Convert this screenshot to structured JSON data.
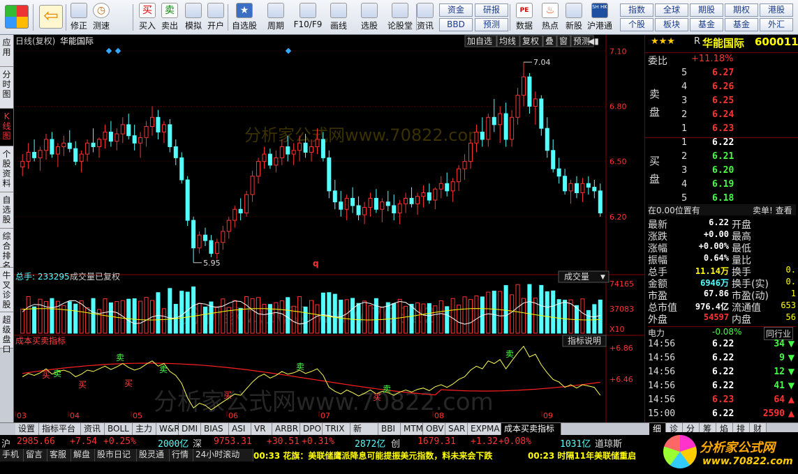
{
  "toolbar": {
    "buttons": [
      {
        "label": "",
        "icon": "grid-icon"
      },
      {
        "label": "",
        "icon": "back-arrow-icon"
      },
      {
        "label": "修正",
        "icon": "arrow-up-down-icon"
      },
      {
        "label": "测速",
        "icon": "clock-icon"
      },
      {
        "label": "买入",
        "icon": "buy-icon"
      },
      {
        "label": "卖出",
        "icon": "sell-icon"
      },
      {
        "label": "模拟",
        "icon": "hammer-icon"
      },
      {
        "label": "开户",
        "icon": "lock-icon"
      },
      {
        "label": "自选股",
        "icon": "star-icon"
      },
      {
        "label": "周期",
        "icon": "cycle-icon"
      },
      {
        "label": "F10/F9",
        "icon": "f10-icon"
      },
      {
        "label": "画线",
        "icon": "pencil-icon"
      },
      {
        "label": "选股",
        "icon": "filter-icon"
      },
      {
        "label": "论股堂",
        "icon": "forum-icon"
      },
      {
        "label": "资讯",
        "icon": "news-icon"
      },
      {
        "label": "数据",
        "icon": "pe-icon"
      },
      {
        "label": "热点",
        "icon": "hot-icon"
      },
      {
        "label": "新股",
        "icon": "ipo-icon"
      },
      {
        "label": "沪港通",
        "icon": "shhk-icon"
      }
    ],
    "glyphs": {
      "buy": "买",
      "sell": "卖",
      "grid": "▦",
      "back": "⇦",
      "pe": "PE",
      "shhk": "SH HK",
      "bbd": "BBD"
    },
    "mid_buttons": [
      "资金",
      "研报",
      "BBD",
      "预测"
    ],
    "right_buttons": [
      "指数",
      "全球",
      "期股",
      "期权",
      "港股",
      "个股",
      "板块",
      "基金",
      "基金",
      "外汇"
    ]
  },
  "left_tabs": [
    "应用",
    "分时图",
    "K线图",
    "个股资料",
    "自选股",
    "综合排名",
    "牛叉诊股",
    "超级盘口"
  ],
  "chart": {
    "header_left": "日线(复权)",
    "stock_name": "华能国际",
    "header_buttons": [
      "加自选",
      "均线",
      "复权",
      "叠",
      "窗",
      "预测"
    ],
    "price_axis": [
      "7.10",
      "6.80",
      "6.50",
      "6.20"
    ],
    "high_label": "7.04",
    "low_label": "5.95",
    "watermark1": "分析家公式网www.70822.com",
    "watermark2": "分析家公式网www.70822.com",
    "watermark3": "分析家公式网 www.70822",
    "vol_label": "总手: 233295",
    "vol_sub": "成交量已复权",
    "vol_dropdown": "成交量",
    "vol_axis": [
      "74165",
      "37083",
      "X10"
    ],
    "ind_label": "成本买卖指标",
    "ind_btn": "指标说明",
    "ind_axis": [
      "+6.86",
      "+6.46"
    ],
    "months": [
      "03",
      "04",
      "05",
      "06",
      "07",
      "08",
      "09"
    ],
    "buy_label": "买",
    "sell_label": "卖",
    "q_mark": "q"
  },
  "chart_data": {
    "type": "candlestick",
    "title": "华能国际 日线(复权)",
    "ylim": [
      5.9,
      7.12
    ],
    "high": 7.04,
    "low": 5.95,
    "candles": [
      [
        6.47,
        6.54,
        6.42,
        6.5
      ],
      [
        6.5,
        6.6,
        6.46,
        6.55
      ],
      [
        6.55,
        6.62,
        6.5,
        6.52
      ],
      [
        6.52,
        6.58,
        6.45,
        6.56
      ],
      [
        6.56,
        6.65,
        6.51,
        6.62
      ],
      [
        6.62,
        6.66,
        6.52,
        6.54
      ],
      [
        6.54,
        6.6,
        6.47,
        6.58
      ],
      [
        6.58,
        6.64,
        6.53,
        6.6
      ],
      [
        6.6,
        6.67,
        6.55,
        6.57
      ],
      [
        6.57,
        6.61,
        6.48,
        6.5
      ],
      [
        6.5,
        6.56,
        6.44,
        6.54
      ],
      [
        6.54,
        6.62,
        6.5,
        6.6
      ],
      [
        6.6,
        6.68,
        6.55,
        6.58
      ],
      [
        6.58,
        6.63,
        6.52,
        6.62
      ],
      [
        6.62,
        6.7,
        6.57,
        6.66
      ],
      [
        6.66,
        6.72,
        6.58,
        6.61
      ],
      [
        6.61,
        6.68,
        6.56,
        6.65
      ],
      [
        6.65,
        6.74,
        6.6,
        6.7
      ],
      [
        6.7,
        6.76,
        6.62,
        6.64
      ],
      [
        6.64,
        6.7,
        6.56,
        6.6
      ],
      [
        6.6,
        6.66,
        6.52,
        6.63
      ],
      [
        6.63,
        6.72,
        6.58,
        6.69
      ],
      [
        6.69,
        6.8,
        6.64,
        6.74
      ],
      [
        6.74,
        6.78,
        6.62,
        6.66
      ],
      [
        6.66,
        6.72,
        6.6,
        6.7
      ],
      [
        6.7,
        6.73,
        6.55,
        6.58
      ],
      [
        6.58,
        6.62,
        6.48,
        6.52
      ],
      [
        6.52,
        6.55,
        6.38,
        6.4
      ],
      [
        6.4,
        6.42,
        6.15,
        6.18
      ],
      [
        6.18,
        6.2,
        5.95,
        6.03
      ],
      [
        6.03,
        6.12,
        6.0,
        6.1
      ],
      [
        6.1,
        6.14,
        6.04,
        6.07
      ],
      [
        6.07,
        6.1,
        5.98,
        6.0
      ],
      [
        6.0,
        6.08,
        5.97,
        6.06
      ],
      [
        6.06,
        6.15,
        6.02,
        6.12
      ],
      [
        6.12,
        6.2,
        6.08,
        6.18
      ],
      [
        6.18,
        6.26,
        6.14,
        6.24
      ],
      [
        6.24,
        6.3,
        6.18,
        6.22
      ],
      [
        6.22,
        6.34,
        6.2,
        6.32
      ],
      [
        6.32,
        6.45,
        6.28,
        6.42
      ],
      [
        6.42,
        6.52,
        6.38,
        6.5
      ],
      [
        6.5,
        6.58,
        6.46,
        6.54
      ],
      [
        6.54,
        6.57,
        6.46,
        6.48
      ],
      [
        6.48,
        6.56,
        6.44,
        6.52
      ],
      [
        6.52,
        6.62,
        6.48,
        6.58
      ],
      [
        6.58,
        6.64,
        6.5,
        6.54
      ],
      [
        6.54,
        6.6,
        6.48,
        6.56
      ],
      [
        6.56,
        6.64,
        6.5,
        6.6
      ],
      [
        6.6,
        6.65,
        6.52,
        6.55
      ],
      [
        6.55,
        6.62,
        6.5,
        6.58
      ],
      [
        6.58,
        6.68,
        6.54,
        6.62
      ],
      [
        6.62,
        6.66,
        6.5,
        6.52
      ],
      [
        6.52,
        6.56,
        6.3,
        6.34
      ],
      [
        6.34,
        6.4,
        6.24,
        6.28
      ],
      [
        6.28,
        6.34,
        6.2,
        6.24
      ],
      [
        6.24,
        6.32,
        6.18,
        6.3
      ],
      [
        6.3,
        6.36,
        6.22,
        6.26
      ],
      [
        6.26,
        6.31,
        6.18,
        6.21
      ],
      [
        6.21,
        6.28,
        6.16,
        6.25
      ],
      [
        6.25,
        6.33,
        6.2,
        6.3
      ],
      [
        6.3,
        6.35,
        6.22,
        6.24
      ],
      [
        6.24,
        6.3,
        6.17,
        6.28
      ],
      [
        6.28,
        6.34,
        6.23,
        6.26
      ],
      [
        6.26,
        6.32,
        6.18,
        6.22
      ],
      [
        6.22,
        6.29,
        6.16,
        6.27
      ],
      [
        6.27,
        6.33,
        6.22,
        6.3
      ],
      [
        6.3,
        6.36,
        6.25,
        6.27
      ],
      [
        6.27,
        6.33,
        6.21,
        6.31
      ],
      [
        6.31,
        6.37,
        6.25,
        6.33
      ],
      [
        6.33,
        6.38,
        6.27,
        6.29
      ],
      [
        6.29,
        6.36,
        6.24,
        6.35
      ],
      [
        6.35,
        6.42,
        6.3,
        6.38
      ],
      [
        6.38,
        6.44,
        6.31,
        6.34
      ],
      [
        6.34,
        6.41,
        6.28,
        6.39
      ],
      [
        6.39,
        6.48,
        6.34,
        6.46
      ],
      [
        6.46,
        6.54,
        6.4,
        6.5
      ],
      [
        6.5,
        6.62,
        6.46,
        6.6
      ],
      [
        6.6,
        6.7,
        6.55,
        6.66
      ],
      [
        6.66,
        6.74,
        6.58,
        6.62
      ],
      [
        6.62,
        6.76,
        6.58,
        6.74
      ],
      [
        6.74,
        6.84,
        6.66,
        6.7
      ],
      [
        6.7,
        6.8,
        6.6,
        6.76
      ],
      [
        6.76,
        6.82,
        6.58,
        6.62
      ],
      [
        6.62,
        6.78,
        6.58,
        6.74
      ],
      [
        6.74,
        6.9,
        6.7,
        6.86
      ],
      [
        6.86,
        7.04,
        6.8,
        6.96
      ],
      [
        6.96,
        6.98,
        6.76,
        6.8
      ],
      [
        6.8,
        6.88,
        6.7,
        6.84
      ],
      [
        6.84,
        6.86,
        6.64,
        6.68
      ],
      [
        6.68,
        6.74,
        6.52,
        6.56
      ],
      [
        6.56,
        6.62,
        6.44,
        6.46
      ],
      [
        6.46,
        6.52,
        6.38,
        6.42
      ],
      [
        6.42,
        6.46,
        6.32,
        6.34
      ],
      [
        6.34,
        6.4,
        6.27,
        6.38
      ],
      [
        6.38,
        6.42,
        6.3,
        6.33
      ],
      [
        6.33,
        6.41,
        6.28,
        6.38
      ],
      [
        6.38,
        6.42,
        6.32,
        6.36
      ],
      [
        6.36,
        6.4,
        6.3,
        6.34
      ],
      [
        6.34,
        6.38,
        6.2,
        6.22
      ]
    ]
  },
  "right_panel": {
    "stars": "★★★",
    "r_flag": "R",
    "name": "华能国际",
    "code": "600011",
    "weibi_label": "委比",
    "weibi_val": "+11.18%",
    "sell_side": "卖盘",
    "buy_side": "买盘",
    "asks": [
      {
        "n": "5",
        "p": "6.27"
      },
      {
        "n": "4",
        "p": "6.26"
      },
      {
        "n": "3",
        "p": "6.25"
      },
      {
        "n": "2",
        "p": "6.24"
      },
      {
        "n": "1",
        "p": "6.23"
      }
    ],
    "bids": [
      {
        "n": "1",
        "p": "6.22"
      },
      {
        "n": "2",
        "p": "6.21"
      },
      {
        "n": "3",
        "p": "6.20"
      },
      {
        "n": "4",
        "p": "6.19"
      },
      {
        "n": "5",
        "p": "6.18"
      }
    ],
    "pos_label": "在0.00位置有",
    "pos_right": "卖单! 查看",
    "stats": [
      {
        "k": "最新",
        "v": "6.22",
        "k2": "开盘"
      },
      {
        "k": "涨跌",
        "v": "+0.00",
        "k2": "最高"
      },
      {
        "k": "涨幅",
        "v": "+0.00%",
        "k2": "最低"
      },
      {
        "k": "振幅",
        "v": "0.64%",
        "k2": "量比"
      },
      {
        "k": "总手",
        "v": "11.14万",
        "k2": "换手",
        "v2": "0."
      },
      {
        "k": "金额",
        "v": "6946万",
        "k2": "换手(实)",
        "v2": "0."
      },
      {
        "k": "市盈",
        "v": "67.86",
        "k2": "市盈(动)",
        "v2": "1"
      },
      {
        "k": "总市值",
        "v": "976.4亿",
        "k2": "流通值",
        "v2": "653"
      },
      {
        "k": "外盘",
        "v": "54597",
        "k2": "内盘",
        "v2": "56"
      }
    ],
    "sector_name": "电力",
    "sector_chg": "-0.08%",
    "sector_btn": "同行业",
    "ticks": [
      {
        "t": "14:56",
        "p": "6.22",
        "v": "34",
        "dir": "down"
      },
      {
        "t": "14:56",
        "p": "6.22",
        "v": "9",
        "dir": "down"
      },
      {
        "t": "14:56",
        "p": "6.22",
        "v": "12",
        "dir": "down"
      },
      {
        "t": "14:56",
        "p": "6.22",
        "v": "41",
        "dir": "down"
      },
      {
        "t": "14:56",
        "p": "6.23",
        "v": "64",
        "dir": "up"
      },
      {
        "t": "15:00",
        "p": "6.22",
        "v": "2590",
        "dir": "up"
      }
    ],
    "mini_tabs": [
      "细",
      "诊",
      "分",
      "筹",
      "焰",
      "排",
      "财"
    ]
  },
  "bottom_tabs": [
    "设置",
    "指标平台",
    "资讯",
    "BOLL",
    "主力",
    "W&R",
    "DMI",
    "BIAS",
    "ASI",
    "VR",
    "ARBR",
    "DPO",
    "TRIX",
    "新DMA",
    "BBI",
    "MTM",
    "OBV",
    "SAR",
    "EXPMA",
    "成本买卖指标"
  ],
  "index_bar": {
    "sh": "沪",
    "sh_val": "2985.66",
    "sh_chg": "+7.54",
    "sh_pct": "+0.25%",
    "sh_amt": "2000亿",
    "sz": "深",
    "sz_val": "9753.31",
    "sz_chg": "+30.51",
    "sz_pct": "+0.31%",
    "sz_amt": "2872亿",
    "cy": "创",
    "cy_val": "1679.31",
    "cy_chg": "+1.32",
    "cy_pct": "+0.08%",
    "cy_amt": "1031亿",
    "dj": "道琼斯"
  },
  "status_bar": {
    "items": [
      "手机",
      "留言",
      "客服",
      "解盘",
      "股市日记",
      "股灵通",
      "行情",
      "24小时滚动"
    ],
    "news1": "00:33 花旗：美联储鹰派降息可能提振美元指数，料未来会下跌",
    "news2": "00:23 时隔11年美联储重启"
  },
  "logo": {
    "text": "分析家公式网",
    "url": "www.70822.com"
  },
  "colors": {
    "up": "#ff3232",
    "down": "#54ffff",
    "yellow": "#ffff00",
    "ma": "#ffffff",
    "red_line": "#ff2020",
    "yellow_line": "#ffff55"
  }
}
